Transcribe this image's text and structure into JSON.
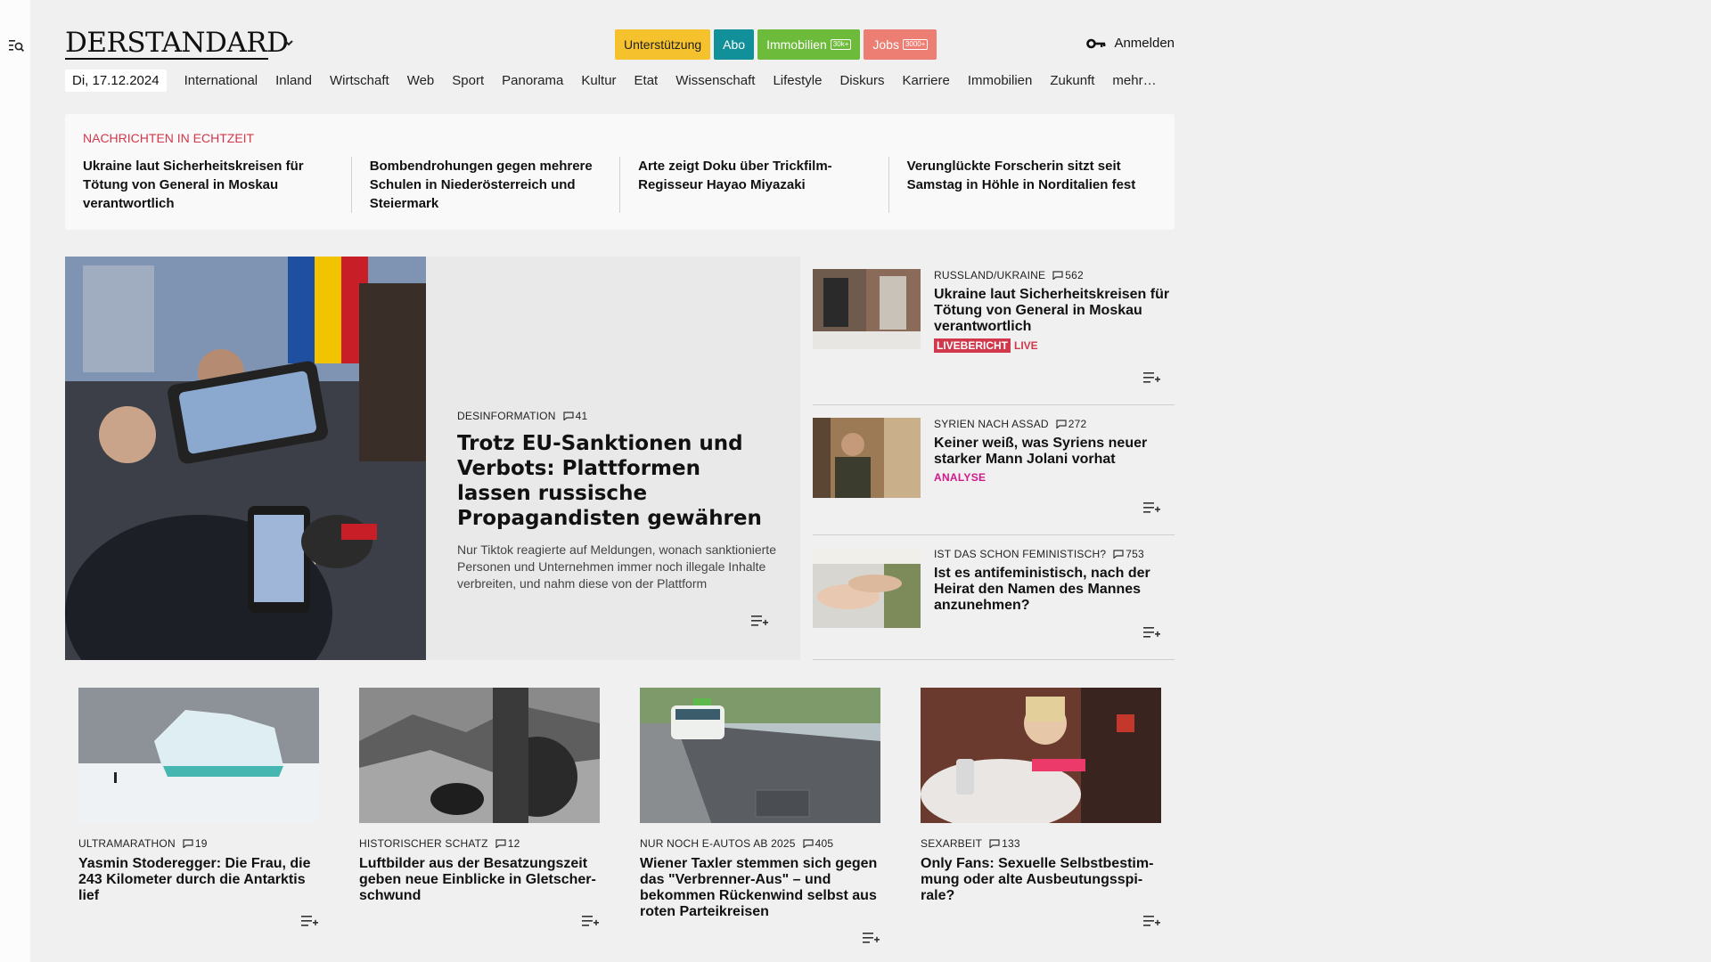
{
  "header": {
    "logo": "DERSTANDARD",
    "pills": {
      "support": "Unterstützung",
      "abo": "Abo",
      "immobilien": "Immobilien",
      "immobilien_count": "30k+",
      "jobs": "Jobs",
      "jobs_count": "3000+"
    },
    "login": "Anmelden"
  },
  "nav": {
    "date": "Di, 17.12.2024",
    "items": [
      "International",
      "Inland",
      "Wirtschaft",
      "Web",
      "Sport",
      "Panorama",
      "Kultur",
      "Etat",
      "Wissenschaft",
      "Lifestyle",
      "Diskurs",
      "Karriere",
      "Immobilien",
      "Zukunft",
      "mehr…"
    ]
  },
  "ticker": {
    "title": "NACHRICHTEN IN ECHTZEIT",
    "items": [
      "Ukraine laut Sicherheitskreisen für Tötung von General in Moskau verantwortlich",
      "Bombendrohungen gegen mehrere Schulen in Niederösterreich und Steiermark",
      "Arte zeigt Doku über Trickfilm-Regis­seur Hayao Miyazaki",
      "Verunglückte Forscherin sitzt seit Samstag in Höhle in Norditalien fest"
    ]
  },
  "lead": {
    "kicker": "DESINFORMATION",
    "comments": "41",
    "headline": "Trotz EU-Sanktionen und Verbots: Plattformen lassen russische Propagandisten gewähren",
    "teaser": "Nur Tiktok reagierte auf Meldungen, wonach sanktionierte Personen und Unternehmen immer noch illegale Inhalte verbreiten, und nahm diese von der Plattform"
  },
  "side": [
    {
      "kicker": "RUSSLAND/UKRAINE",
      "comments": "562",
      "headline": "Ukraine laut Sicherheitskreisen für Tötung von General in Moskau verantwortlich",
      "tag": "LIVEBERICHT",
      "tag2": "LIVE"
    },
    {
      "kicker": "SYRIEN NACH ASSAD",
      "comments": "272",
      "headline": "Keiner weiß, was Syriens neuer starker Mann Jolani vorhat",
      "tag": "ANALYSE"
    },
    {
      "kicker": "IST DAS SCHON FEMINISTISCH?",
      "comments": "753",
      "headline": "Ist es antifeministisch, nach der Heirat den Namen des Mannes anzunehmen?"
    }
  ],
  "cards": [
    {
      "kicker": "ULTRAMARATHON",
      "comments": "19",
      "headline": "Yasmin Stoderegger: Die Frau, die 243 Kilometer durch die Antarktis lief"
    },
    {
      "kicker": "HISTORISCHER SCHATZ",
      "comments": "12",
      "headline": "Luftbilder aus der Besatzungszeit geben neue Einblicke in Gletscher­schwund"
    },
    {
      "kicker": "NUR NOCH E-AUTOS AB 2025",
      "comments": "405",
      "headline": "Wiener Taxler stemmen sich gegen das \"Verbrenner-Aus\" – und bekommen Rückenwind selbst aus roten Parteikreisen"
    },
    {
      "kicker": "SEXARBEIT",
      "comments": "133",
      "headline": "Only Fans: Sexuelle Selbstbestim­mung oder alte Ausbeutungsspi­rale?"
    }
  ],
  "colors": {
    "accent_red": "#d1384b",
    "analyse_magenta": "#d0198a",
    "support_yellow": "#f5c22e",
    "abo_teal": "#12909a",
    "immo_green": "#6dbb3a",
    "jobs_salmon": "#ec7e74"
  },
  "icons": {
    "rail": "search-menu-icon",
    "login": "key-icon",
    "comments": "comment-icon",
    "readlist": "add-to-list-icon"
  }
}
